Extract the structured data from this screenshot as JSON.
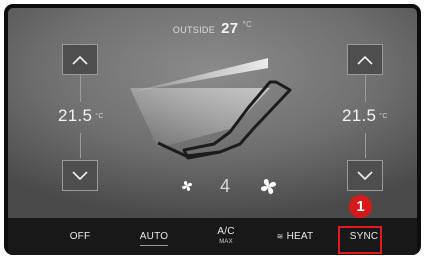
{
  "outside": {
    "label": "OUTSIDE",
    "value": "27",
    "unit": "°C"
  },
  "left_zone": {
    "temperature": "21.5",
    "unit": "°C"
  },
  "right_zone": {
    "temperature": "21.5",
    "unit": "°C"
  },
  "fan": {
    "level": "4"
  },
  "bottom_bar": {
    "off": "OFF",
    "auto": "AUTO",
    "ac": "A/C",
    "ac_sub": "MAX",
    "heat": "HEAT",
    "sync": "SYNC"
  },
  "callout": {
    "number": "1",
    "color": "#d61a1a"
  },
  "colors": {
    "highlight": "#e01a1a",
    "background": "#0e0e0e"
  }
}
